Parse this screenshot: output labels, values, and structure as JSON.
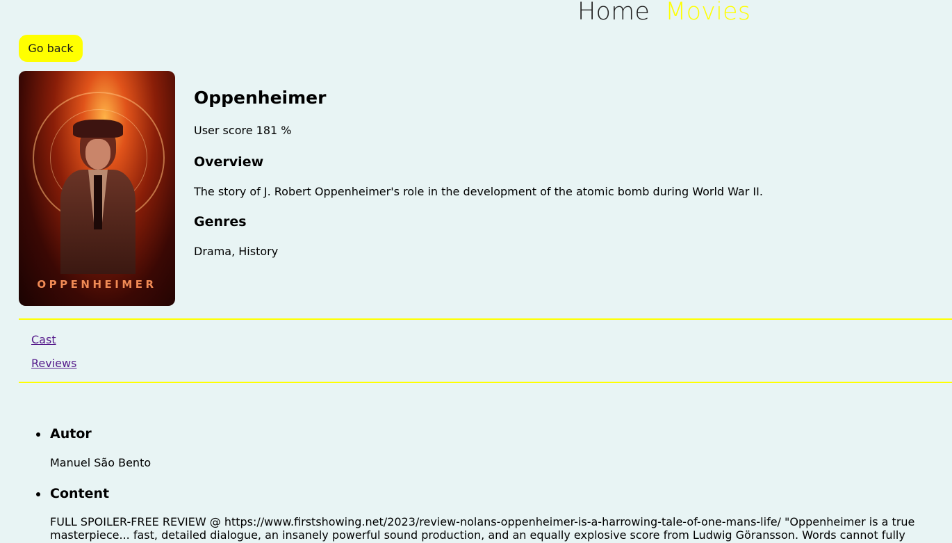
{
  "nav": {
    "home": "Home",
    "movies": "Movies"
  },
  "actions": {
    "go_back": "Go back"
  },
  "movie": {
    "poster_title": "OPPENHEIMER",
    "title": "Oppenheimer",
    "user_score": "User score 181 %",
    "overview_heading": "Overview",
    "overview": "The story of J. Robert Oppenheimer's role in the development of the atomic bomb during World War II.",
    "genres_heading": "Genres",
    "genres": "Drama, History"
  },
  "links": {
    "cast": "Cast",
    "reviews": "Reviews"
  },
  "review": {
    "author_label": "Autor",
    "author": "Manuel São Bento",
    "content_label": "Content",
    "content": "FULL SPOILER-FREE REVIEW @ https://www.firstshowing.net/2023/review-nolans-oppenheimer-is-a-harrowing-tale-of-one-mans-life/ \"Oppenheimer is a true masterpiece... fast, detailed dialogue, an insanely powerful sound production, and an equally explosive score from Ludwig Göransson. Words cannot fully describe Hoyte van Hoytema's"
  },
  "colors": {
    "background": "#e8f4f4",
    "accent": "#ffff00",
    "link": "#551a8b"
  }
}
